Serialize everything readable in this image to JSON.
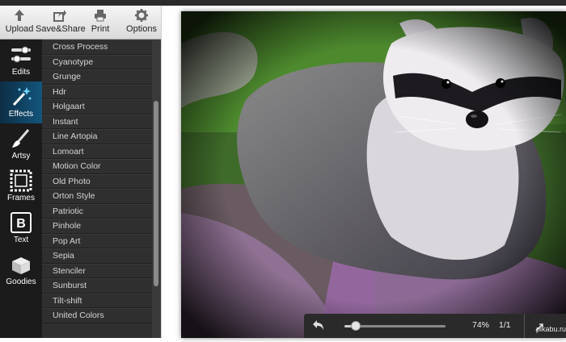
{
  "toolbar": {
    "upload": "Upload",
    "save_share": "Save&Share",
    "print": "Print",
    "options": "Options"
  },
  "rail": {
    "items": [
      {
        "label": "Edits",
        "icon": "sliders-icon"
      },
      {
        "label": "Effects",
        "icon": "magic-wand-icon",
        "active": true
      },
      {
        "label": "Artsy",
        "icon": "paintbrush-icon"
      },
      {
        "label": "Frames",
        "icon": "frame-icon"
      },
      {
        "label": "Text",
        "icon": "text-icon"
      },
      {
        "label": "Goodies",
        "icon": "gift-box-icon"
      }
    ]
  },
  "effects": {
    "items": [
      "Cross Process",
      "Cyanotype",
      "Grunge",
      "Hdr",
      "Holgaart",
      "Instant",
      "Line Artopia",
      "Lomoart",
      "Motion Color",
      "Old Photo",
      "Orton Style",
      "Patriotic",
      "Pinhole",
      "Pop Art",
      "Sepia",
      "Stenciler",
      "Sunburst",
      "Tilt-shift",
      "United Colors"
    ]
  },
  "viewer": {
    "zoom": "74%",
    "zoom_fraction": 0.74,
    "page": "1/1"
  },
  "watermark": "pikabu.ru",
  "colors": {
    "active_rail": "#14557c",
    "list_bg": "#2f2f2f",
    "rail_bg": "#1b1b1b"
  }
}
